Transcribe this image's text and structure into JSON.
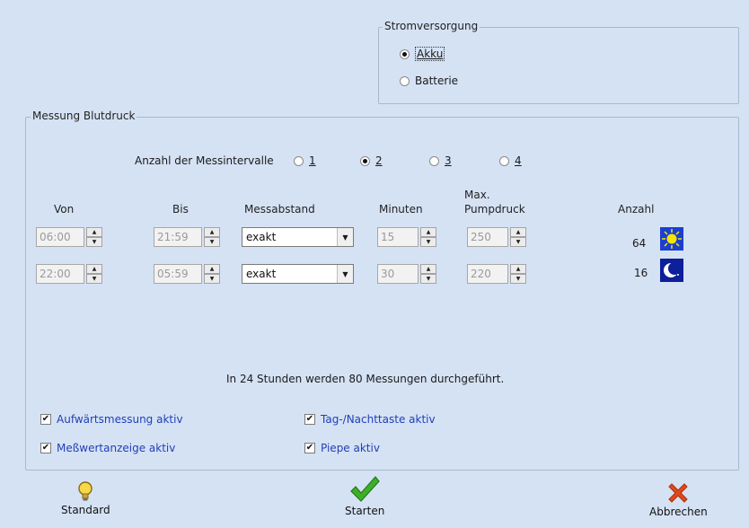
{
  "power": {
    "title": "Stromversorgung",
    "options": [
      {
        "label": "Akku",
        "selected": true
      },
      {
        "label": "Batterie",
        "selected": false
      }
    ]
  },
  "measurement": {
    "title": "Messung Blutdruck",
    "intervals_label": "Anzahl der Messintervalle",
    "interval_options": [
      {
        "label": "1",
        "selected": false
      },
      {
        "label": "2",
        "selected": true
      },
      {
        "label": "3",
        "selected": false
      },
      {
        "label": "4",
        "selected": false
      }
    ],
    "headers": {
      "von": "Von",
      "bis": "Bis",
      "messabstand": "Messabstand",
      "minuten": "Minuten",
      "max_pump_1": "Max.",
      "max_pump_2": "Pumpdruck",
      "anzahl": "Anzahl"
    },
    "rows": [
      {
        "von": "06:00",
        "bis": "21:59",
        "messabstand": "exakt",
        "minuten": "15",
        "pumpdruck": "250",
        "anzahl": "64",
        "icon": "sun-icon"
      },
      {
        "von": "22:00",
        "bis": "05:59",
        "messabstand": "exakt",
        "minuten": "30",
        "pumpdruck": "220",
        "anzahl": "16",
        "icon": "moon-icon"
      }
    ],
    "summary": "In 24 Stunden werden  80 Messungen durchgeführt.",
    "checks": [
      {
        "label": "Aufwärtsmessung aktiv",
        "checked": true
      },
      {
        "label": "Meßwertanzeige aktiv",
        "checked": true
      },
      {
        "label": "Tag-/Nachttaste aktiv",
        "checked": true
      },
      {
        "label": "Piepe aktiv",
        "checked": true
      }
    ]
  },
  "buttons": {
    "standard": "Standard",
    "starten": "Starten",
    "abbrechen": "Abbrechen"
  }
}
